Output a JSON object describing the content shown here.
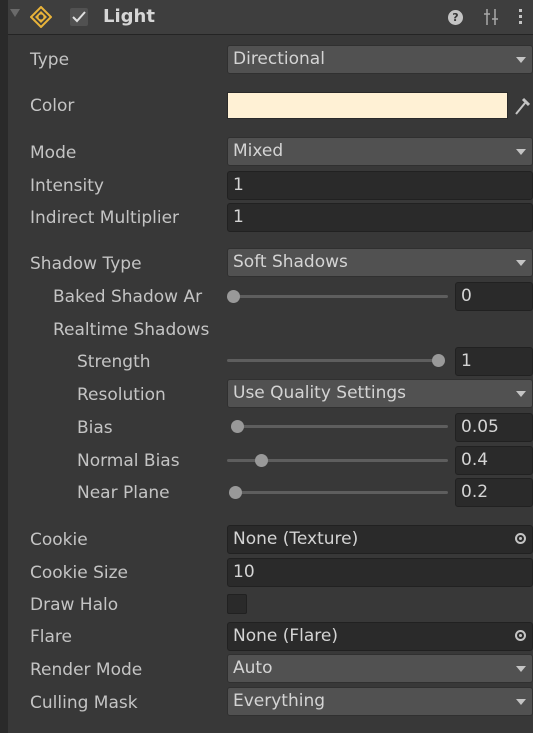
{
  "header": {
    "title": "Light",
    "enabled": true
  },
  "type": {
    "label": "Type",
    "value": "Directional"
  },
  "color": {
    "label": "Color",
    "swatch": "#fff1d5"
  },
  "mode": {
    "label": "Mode",
    "value": "Mixed"
  },
  "intensity": {
    "label": "Intensity",
    "value": "1"
  },
  "indirect_multiplier": {
    "label": "Indirect Multiplier",
    "value": "1"
  },
  "shadow_type": {
    "label": "Shadow Type",
    "value": "Soft Shadows"
  },
  "baked_shadow": {
    "label": "Baked Shadow Ar",
    "value": "0",
    "fraction": 0.0
  },
  "realtime_shadows": {
    "label": "Realtime Shadows"
  },
  "strength": {
    "label": "Strength",
    "value": "1",
    "fraction": 1.0
  },
  "resolution": {
    "label": "Resolution",
    "value": "Use Quality Settings"
  },
  "bias": {
    "label": "Bias",
    "value": "0.05",
    "fraction": 0.05
  },
  "normal_bias": {
    "label": "Normal Bias",
    "value": "0.4",
    "fraction": 0.13
  },
  "near_plane": {
    "label": "Near Plane",
    "value": "0.2",
    "fraction": 0.02
  },
  "cookie": {
    "label": "Cookie",
    "value": "None (Texture)"
  },
  "cookie_size": {
    "label": "Cookie Size",
    "value": "10"
  },
  "draw_halo": {
    "label": "Draw Halo",
    "checked": false
  },
  "flare": {
    "label": "Flare",
    "value": "None (Flare)"
  },
  "render_mode": {
    "label": "Render Mode",
    "value": "Auto"
  },
  "culling_mask": {
    "label": "Culling Mask",
    "value": "Everything"
  },
  "icons": [
    "fold-arrow-icon",
    "light-icon",
    "checkmark-icon",
    "help-icon",
    "preset-icon",
    "kebab-menu-icon",
    "eyedropper-icon",
    "object-picker-icon",
    "dropdown-caret-icon"
  ]
}
